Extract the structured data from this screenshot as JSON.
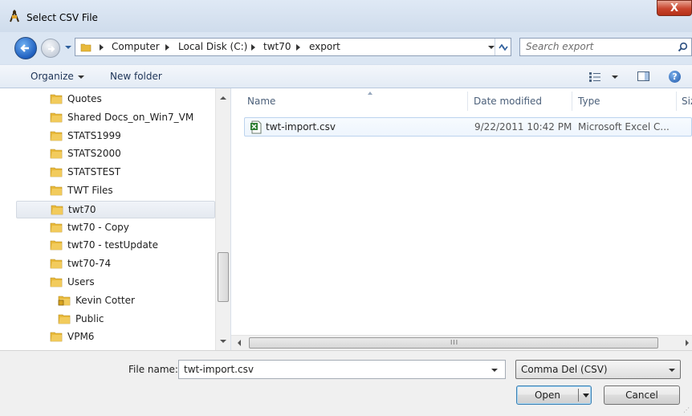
{
  "window": {
    "title": "Select CSV File",
    "close_label": "X"
  },
  "address": {
    "crumbs": [
      "Computer",
      "Local Disk (C:)",
      "twt70",
      "export"
    ],
    "search_placeholder": "Search export"
  },
  "toolbar": {
    "organize_label": "Organize",
    "new_folder_label": "New folder"
  },
  "nav_tree": [
    {
      "label": "Quotes",
      "indent": 0
    },
    {
      "label": "Shared Docs_on_Win7_VM",
      "indent": 0
    },
    {
      "label": "STATS1999",
      "indent": 0
    },
    {
      "label": "STATS2000",
      "indent": 0
    },
    {
      "label": "STATSTEST",
      "indent": 0
    },
    {
      "label": "TWT Files",
      "indent": 0
    },
    {
      "label": "twt70",
      "indent": 0,
      "selected": true
    },
    {
      "label": "twt70 - Copy",
      "indent": 0
    },
    {
      "label": "twt70 - testUpdate",
      "indent": 0
    },
    {
      "label": "twt70-74",
      "indent": 0
    },
    {
      "label": "Users",
      "indent": 0
    },
    {
      "label": "Kevin Cotter",
      "indent": 1,
      "locked": true
    },
    {
      "label": "Public",
      "indent": 1
    },
    {
      "label": "VPM6",
      "indent": 0
    }
  ],
  "columns": {
    "name": "Name",
    "date": "Date modified",
    "type": "Type",
    "size": "Siz"
  },
  "files": [
    {
      "name": "twt-import.csv",
      "date": "9/22/2011 10:42 PM",
      "type": "Microsoft Excel C..."
    }
  ],
  "bottom": {
    "file_name_label": "File name:",
    "file_name_value": "twt-import.csv",
    "filter_value": "Comma Del (CSV)",
    "open_label": "Open",
    "cancel_label": "Cancel"
  },
  "colors": {
    "accent": "#3c7fb1",
    "close": "#c8442d",
    "folder": "#e8b93a"
  }
}
